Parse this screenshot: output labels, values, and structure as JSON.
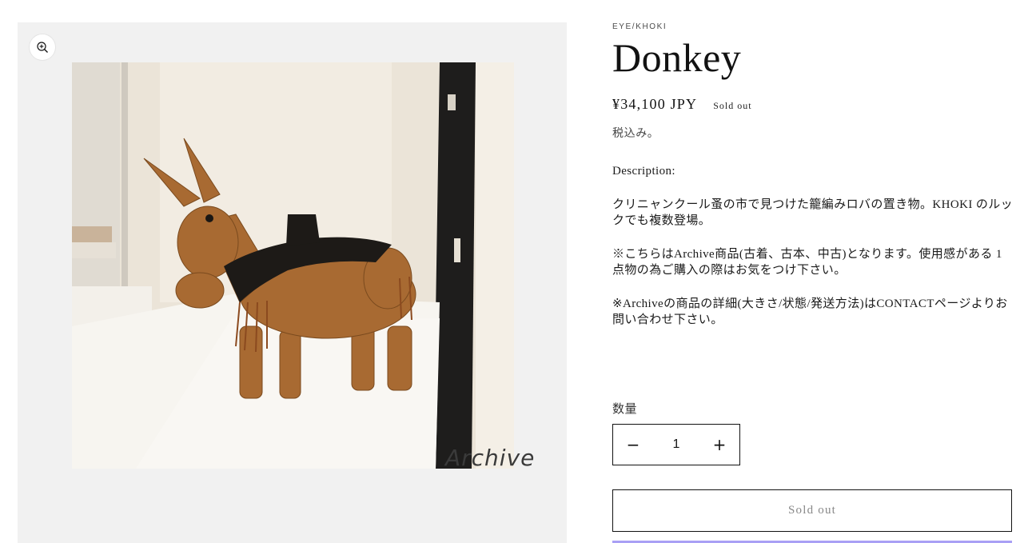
{
  "product": {
    "vendor": "EYE/KHOKI",
    "title": "Donkey",
    "price": "¥34,100 JPY",
    "badge": "Sold out",
    "tax_note": "税込み。",
    "description": [
      "Description:",
      "クリニャンクール蚤の市で見つけた籠編みロバの置き物。KHOKI のルックでも複数登場。",
      "※こちらはArchive商品(古着、古本、中古)となります。使用感がある 1点物の為ご購入の際はお気をつけ下さい。",
      "※Archiveの商品の詳細(大きさ/状態/発送方法)はCONTACTページよりお問い合わせ下さい。"
    ]
  },
  "media": {
    "zoom_icon": "zoom-in-icon",
    "watermark": "Archive"
  },
  "quantity": {
    "label": "数量",
    "value": "1",
    "decrease_icon": "minus-icon",
    "increase_icon": "plus-icon"
  },
  "cart": {
    "button_label": "Sold out"
  },
  "colors": {
    "accent_bar": "#a9a0f5",
    "text": "#121212",
    "media_bg": "#f1f1f1"
  }
}
